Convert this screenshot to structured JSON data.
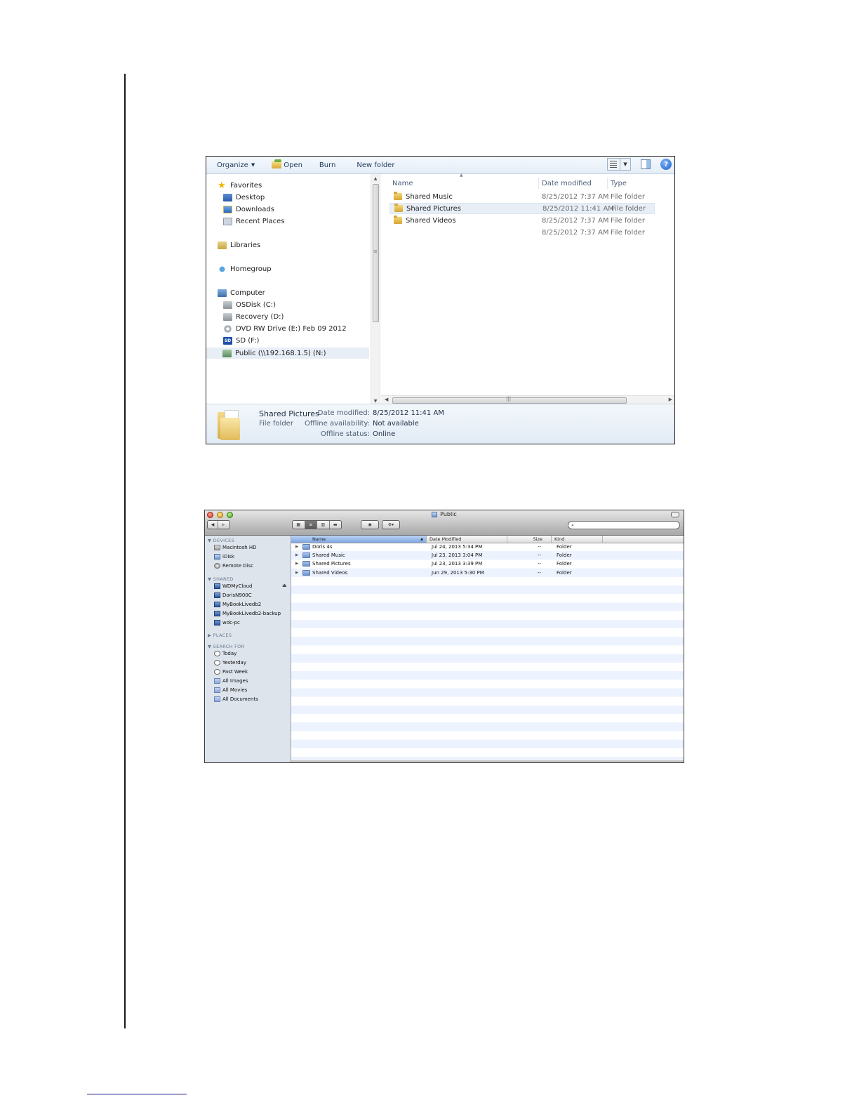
{
  "windows_explorer": {
    "toolbar": {
      "organize_label": "Organize",
      "open_label": "Open",
      "burn_label": "Burn",
      "new_folder_label": "New folder",
      "help_label": "?"
    },
    "nav": {
      "favorites": "Favorites",
      "desktop": "Desktop",
      "downloads": "Downloads",
      "recent_places": "Recent Places",
      "libraries": "Libraries",
      "homegroup": "Homegroup",
      "computer": "Computer",
      "osdisk": "OSDisk (C:)",
      "recovery": "Recovery (D:)",
      "dvd": "DVD RW Drive (E:) Feb 09 2012",
      "sd": "SD (F:)",
      "sd_badge": "SD",
      "public": "Public (\\\\192.168.1.5) (N:)"
    },
    "columns": {
      "name": "Name",
      "date_modified": "Date modified",
      "type": "Type"
    },
    "files": [
      {
        "name": "Shared Music",
        "date": "8/25/2012 7:37 AM",
        "type": "File folder"
      },
      {
        "name": "Shared Pictures",
        "date": "8/25/2012 11:41 AM",
        "type": "File folder"
      },
      {
        "name": "Shared Videos",
        "date": "8/25/2012 7:37 AM",
        "type": "File folder"
      },
      {
        "name": "",
        "date": "8/25/2012 7:37 AM",
        "type": "File folder"
      }
    ],
    "details": {
      "name": "Shared Pictures",
      "kind": "File folder",
      "date_modified_label": "Date modified:",
      "date_modified_value": "8/25/2012 11:41 AM",
      "offline_availability_label": "Offline availability:",
      "offline_availability_value": "Not available",
      "offline_status_label": "Offline status:",
      "offline_status_value": "Online"
    }
  },
  "mac_finder": {
    "title": "Public",
    "sidebar": {
      "devices_header": "DEVICES",
      "devices": [
        "Macintosh HD",
        "iDisk",
        "Remote Disc"
      ],
      "shared_header": "SHARED",
      "shared": [
        "WDMyCloud",
        "DorisN900C",
        "MyBookLivedb2",
        "MyBookLivedb2-backup",
        "wdc-pc"
      ],
      "places_header": "PLACES",
      "search_header": "SEARCH FOR",
      "search_items": [
        "Today",
        "Yesterday",
        "Past Week",
        "All Images",
        "All Movies",
        "All Documents"
      ]
    },
    "columns": {
      "name": "Name",
      "date_modified": "Date Modified",
      "size": "Size",
      "kind": "Kind"
    },
    "files": [
      {
        "name": "Doris 4s",
        "date": "Jul 24, 2013 5:34 PM",
        "size": "--",
        "kind": "Folder"
      },
      {
        "name": "Shared Music",
        "date": "Jul 23, 2013 3:04 PM",
        "size": "--",
        "kind": "Folder"
      },
      {
        "name": "Shared Pictures",
        "date": "Jul 23, 2013 3:39 PM",
        "size": "--",
        "kind": "Folder"
      },
      {
        "name": "Shared Videos",
        "date": "Jun 29, 2013 5:30 PM",
        "size": "--",
        "kind": "Folder"
      }
    ]
  }
}
